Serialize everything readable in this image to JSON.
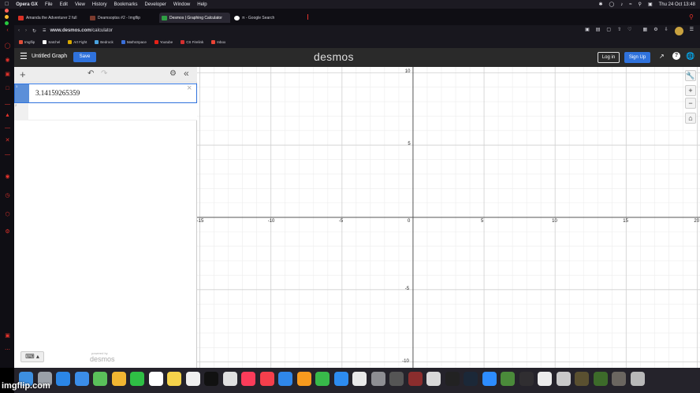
{
  "menubar": {
    "items": [
      "Opera GX",
      "File",
      "Edit",
      "View",
      "History",
      "Bookmarks",
      "Developer",
      "Window",
      "Help"
    ],
    "clock": "Thu 24 Oct  13:48"
  },
  "tabs": [
    {
      "label": "Amanda the Adventurer 2 full",
      "color": "#d93025"
    },
    {
      "label": "Deamsoptss #2 - Imgflip",
      "color": "#7b3b2e"
    },
    {
      "label": "Desmos | Graphing Calculator",
      "color": "#2f9e44",
      "active": true
    },
    {
      "label": "π - Google Search",
      "color": "#ffffff"
    }
  ],
  "address": {
    "domain": "www.desmos.com",
    "path": "/calculator"
  },
  "bookmarks": [
    {
      "label": "Imgflip",
      "color": "#e04e39"
    },
    {
      "label": "Satchel",
      "color": "#fff"
    },
    {
      "label": "Art Fight",
      "color": "#d9a900"
    },
    {
      "label": "Bedrock",
      "color": "#4aa3df"
    },
    {
      "label": "MathsSpace",
      "color": "#3a6fd8"
    },
    {
      "label": "Youtube",
      "color": "#e62117"
    },
    {
      "label": "CS Firelink",
      "color": "#d32f2f"
    },
    {
      "label": "Inbox",
      "color": "#ea4335"
    }
  ],
  "header": {
    "title": "Untitled Graph",
    "save": "Save",
    "logo": "desmos",
    "login": "Log in",
    "signup": "Sign Up"
  },
  "expressions": [
    {
      "index": "1",
      "value": "3.14159265359"
    },
    {
      "index": "2",
      "value": ""
    }
  ],
  "powered": {
    "line1": "powered by",
    "line2": "desmos"
  },
  "axes": {
    "x_ticks": [
      "-15",
      "-10",
      "-5",
      "0",
      "5",
      "10",
      "15",
      "20"
    ],
    "y_ticks": [
      "10",
      "5",
      "-5",
      "-10"
    ],
    "xlim": [
      -15.2,
      20.2
    ],
    "ylim": [
      -10.4,
      10.4
    ]
  },
  "watermark": "imgflip.com"
}
